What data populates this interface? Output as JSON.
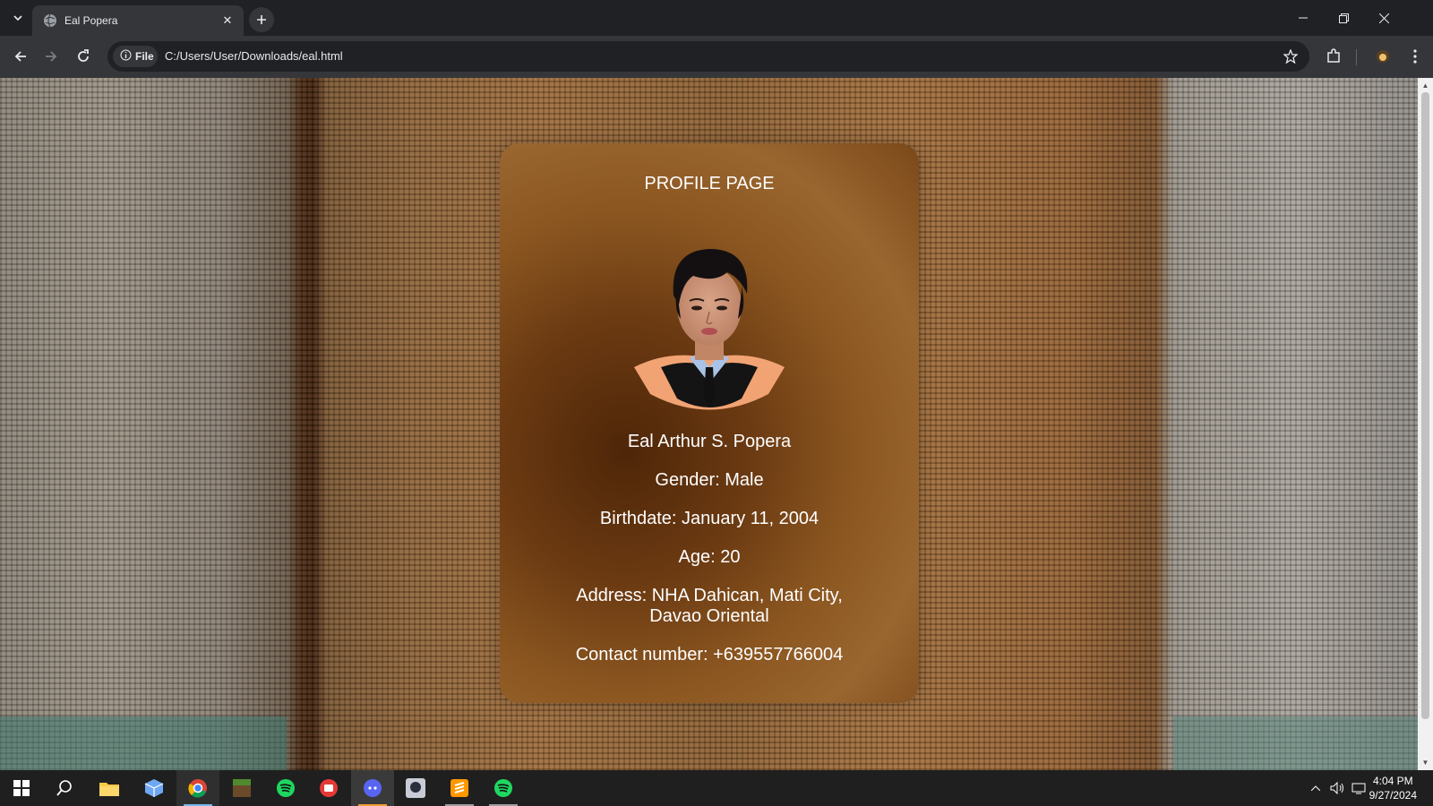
{
  "browser": {
    "tab_title": "Eal Popera",
    "url": "C:/Users/User/Downloads/eal.html",
    "scheme_chip": "File"
  },
  "profile": {
    "heading": "PROFILE PAGE",
    "name": "Eal Arthur S. Popera",
    "gender": "Gender: Male",
    "birthdate": "Birthdate: January 11, 2004",
    "age": "Age: 20",
    "address_line1": "Address: NHA Dahican, Mati City,",
    "address_line2": "Davao Oriental",
    "contact": "Contact number: +639557766004"
  },
  "taskbar": {
    "time": "4:04 PM",
    "date": "9/27/2024",
    "apps": [
      "start-icon",
      "search-icon",
      "file-explorer-icon",
      "app-cube-icon",
      "chrome-icon",
      "minecraft-icon",
      "spotify-icon",
      "app-red-icon",
      "discord-icon",
      "game-character-icon",
      "sublime-text-icon",
      "spotify-icon"
    ]
  },
  "colors": {
    "chrome_dark": "#202124",
    "toolbar": "#35363a",
    "card_brown": "#8b5620",
    "taskbar": "#1f1f1f"
  }
}
